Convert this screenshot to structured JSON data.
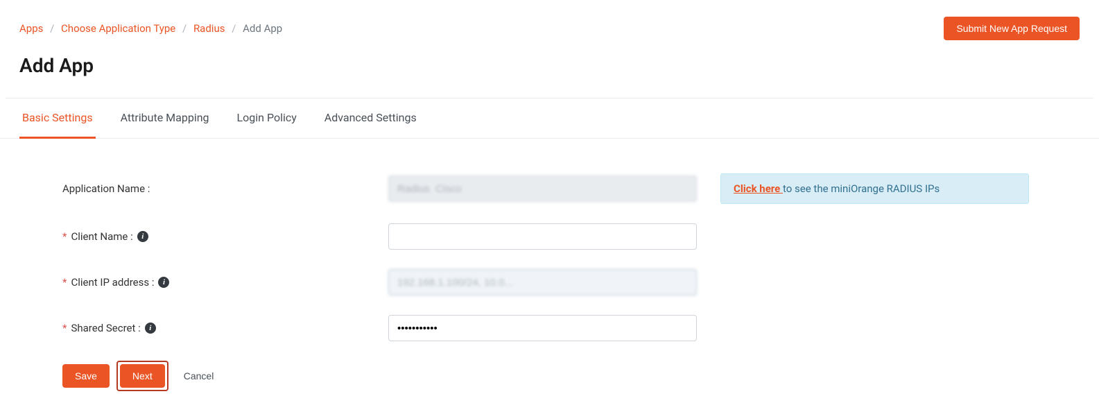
{
  "breadcrumb": {
    "items": [
      "Apps",
      "Choose Application Type",
      "Radius"
    ],
    "current": "Add App"
  },
  "header": {
    "submit_button": "Submit New App Request",
    "title": "Add App"
  },
  "tabs": {
    "items": [
      {
        "label": "Basic Settings",
        "active": true
      },
      {
        "label": "Attribute Mapping",
        "active": false
      },
      {
        "label": "Login Policy",
        "active": false
      },
      {
        "label": "Advanced Settings",
        "active": false
      }
    ]
  },
  "form": {
    "app_name": {
      "label": "Application Name :",
      "value": "Radius  Cisco"
    },
    "client_name": {
      "label": "Client Name :",
      "value": ""
    },
    "client_ip": {
      "label": "Client IP address :",
      "value": "192.168.1.100/24, 10.0..."
    },
    "shared_secret": {
      "label": "Shared Secret :",
      "value": "•••••••••••"
    }
  },
  "alert": {
    "link": "Click here ",
    "text": "to see the miniOrange RADIUS IPs"
  },
  "actions": {
    "save": "Save",
    "next": "Next",
    "cancel": "Cancel"
  }
}
